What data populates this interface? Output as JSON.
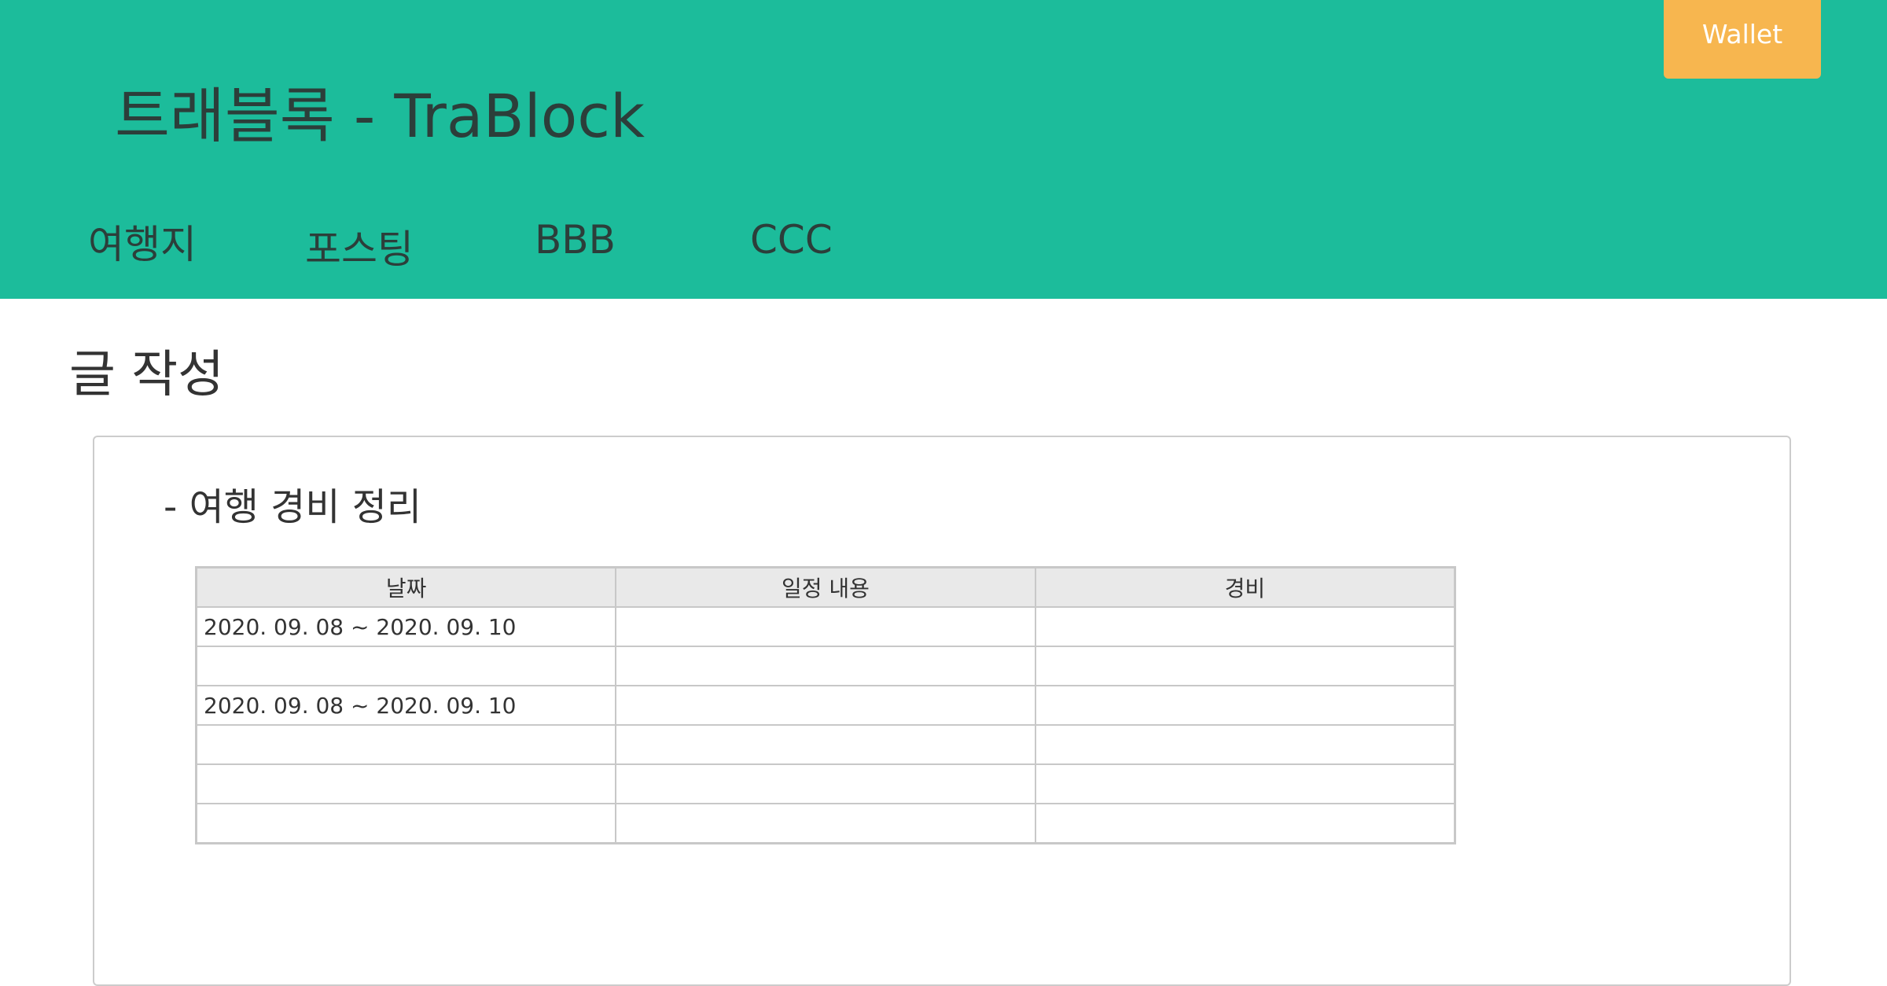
{
  "header": {
    "site_title": "트래블록 - TraBlock",
    "wallet_label": "Wallet",
    "nav": [
      {
        "label": "여행지"
      },
      {
        "label": "포스팅"
      },
      {
        "label": "BBB"
      },
      {
        "label": "CCC"
      }
    ]
  },
  "main": {
    "page_title": "글 작성",
    "section_title": "- 여행 경비 정리",
    "table": {
      "columns": [
        "날짜",
        "일정 내용",
        "경비"
      ],
      "rows": [
        [
          "2020. 09. 08 ~ 2020. 09. 10",
          "",
          ""
        ],
        [
          "",
          "",
          ""
        ],
        [
          "2020. 09. 08 ~ 2020. 09. 10",
          "",
          ""
        ],
        [
          "",
          "",
          ""
        ],
        [
          "",
          "",
          ""
        ],
        [
          "",
          "",
          ""
        ]
      ]
    }
  },
  "colors": {
    "header_bg": "#1cbc9b",
    "wallet_bg": "#f7b64f",
    "table_header_bg": "#e9e9e9"
  }
}
